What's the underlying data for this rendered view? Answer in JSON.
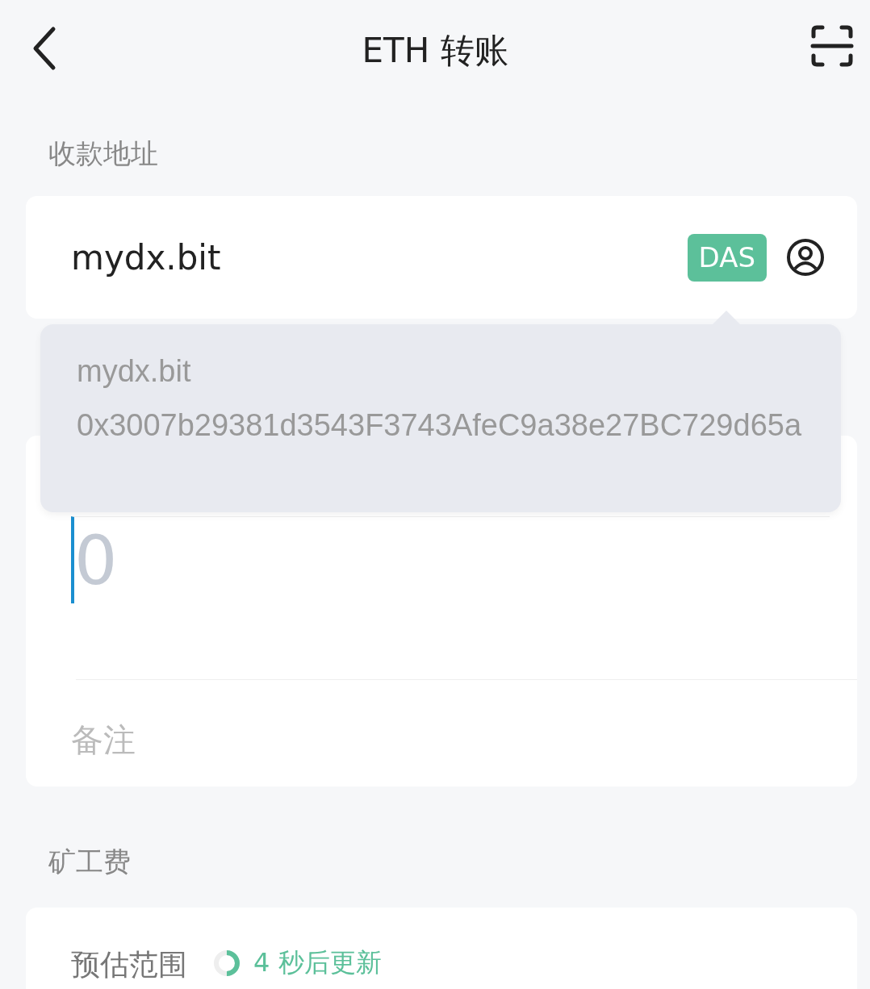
{
  "header": {
    "title": "ETH 转账"
  },
  "recipient": {
    "label": "收款地址",
    "value": "mydx.bit",
    "tag": "DAS"
  },
  "suggestion": {
    "name": "mydx.bit",
    "address": "0x3007b29381d3543F3743AfeC9a38e27BC729d65a"
  },
  "amount": {
    "placeholder": "0"
  },
  "memo": {
    "placeholder": "备注"
  },
  "fee": {
    "label": "矿工费",
    "range_label": "预估范围",
    "countdown": "4 秒后更新"
  }
}
